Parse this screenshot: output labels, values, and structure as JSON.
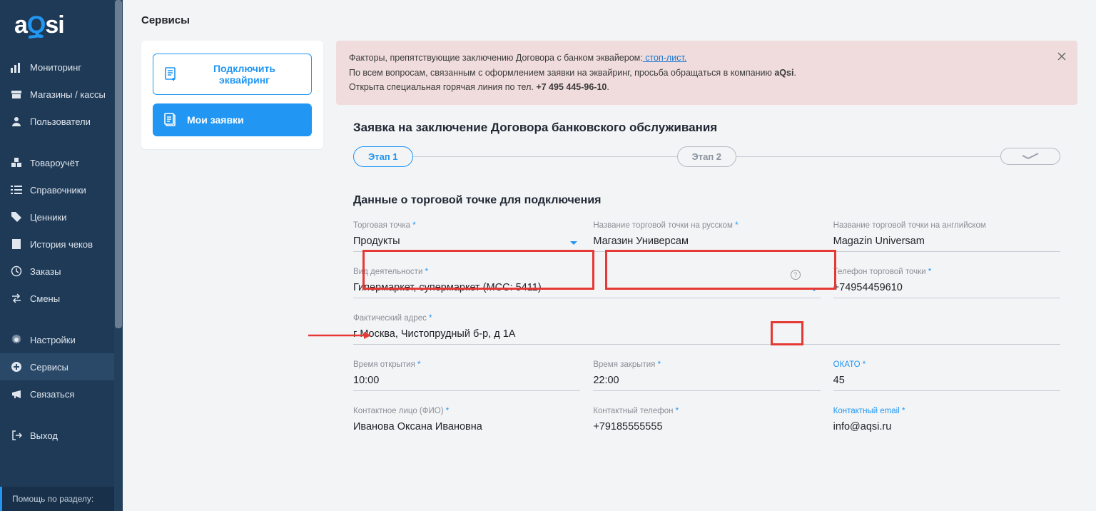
{
  "logo": {
    "a": "a",
    "Q": "Q",
    "si": "si"
  },
  "sidebar": {
    "items": [
      {
        "label": "Мониторинг"
      },
      {
        "label": "Магазины / кассы"
      },
      {
        "label": "Пользователи"
      },
      {
        "label": "Товароучёт"
      },
      {
        "label": "Справочники"
      },
      {
        "label": "Ценники"
      },
      {
        "label": "История чеков"
      },
      {
        "label": "Заказы"
      },
      {
        "label": "Смены"
      },
      {
        "label": "Настройки"
      },
      {
        "label": "Сервисы"
      },
      {
        "label": "Связаться"
      },
      {
        "label": "Выход"
      }
    ],
    "help": "Помощь по разделу:"
  },
  "page_title": "Сервисы",
  "left_buttons": {
    "connect": "Подключить эквайринг",
    "my": "Мои заявки"
  },
  "alert": {
    "line1_a": "Факторы, препятствующие заключению Договора с банком эквайером:",
    "line1_link": " стоп-лист.",
    "line2_a": "По всем вопросам, связанным с оформлением заявки на эквайринг, просьба обращаться в компанию ",
    "line2_b": "aQsi",
    "line2_c": ".",
    "line3_a": "Открыта специальная горячая линия по тел. ",
    "line3_b": "+7 495 445-96-10",
    "line3_c": "."
  },
  "card_title": "Заявка на заключение Договора банковского обслуживания",
  "steps": {
    "s1": "Этап 1",
    "s2": "Этап 2"
  },
  "section": "Данные о торговой точке для подключения",
  "fields": {
    "trade_point": {
      "label": "Торговая точка",
      "value": "Продукты"
    },
    "name_ru": {
      "label": "Название торговой точки на русском",
      "value": "Магазин Универсам"
    },
    "name_en": {
      "label": "Название торговой точки на английском",
      "value": "Magazin Universam"
    },
    "activity": {
      "label": "Вид деятельности",
      "value": "Гипермаркет, супермаркет (MCC: 5411)"
    },
    "phone_point": {
      "label": "Телефон торговой точки",
      "value": "+74954459610"
    },
    "address": {
      "label": "Фактический адрес",
      "value": "г Москва, Чистопрудный б-р, д 1А"
    },
    "open": {
      "label": "Время открытия",
      "value": "10:00"
    },
    "close": {
      "label": "Время закрытия",
      "value": "22:00"
    },
    "okato": {
      "label": "ОКАТО",
      "value": "45"
    },
    "contact_name": {
      "label": "Контактное лицо (ФИО)",
      "value": "Иванова Оксана Ивановна"
    },
    "contact_phone": {
      "label": "Контактный телефон",
      "value": "+79185555555"
    },
    "contact_email": {
      "label": "Контактный email",
      "value": "info@aqsi.ru"
    }
  }
}
